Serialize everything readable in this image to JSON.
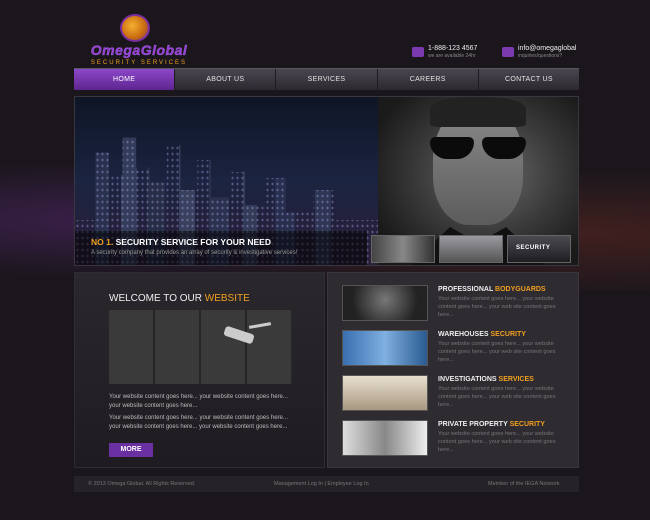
{
  "brand": {
    "name": "OmegaGlobal",
    "tagline": "SECURITY SERVICES"
  },
  "contact": {
    "phone": "1-888-123 4567",
    "phone_sub": "we are available 24hr",
    "email": "info@omegaglobal",
    "email_sub": "inquiries/questions?"
  },
  "nav": {
    "items": [
      {
        "label": "HOME"
      },
      {
        "label": "ABOUT US"
      },
      {
        "label": "SERVICES"
      },
      {
        "label": "CAREERS"
      },
      {
        "label": "CONTACT US"
      }
    ]
  },
  "hero": {
    "title_hl": "NO 1.",
    "title_rest": " SECURITY SERVICE FOR YOUR NEED",
    "desc": "A security company that provides an array of security & investigative services!",
    "thumbs": [
      {
        "label": ""
      },
      {
        "label": ""
      },
      {
        "label": "SECURITY"
      }
    ]
  },
  "welcome": {
    "title_plain": "WELCOME TO OUR ",
    "title_hl": "WEBSITE",
    "para1": "Your website content goes here... your website content goes here... your website content goes here...",
    "para2": "Your website content goes here... your website content goes here... your website content goes here... your website content goes here...",
    "more_label": "MORE"
  },
  "services": [
    {
      "title_plain": "PROFESSIONAL ",
      "title_hl": "BODYGUARDS",
      "text": "Your website content goes here... your website content goes here... your web site content goes here..."
    },
    {
      "title_plain": "WAREHOUSES ",
      "title_hl": "SECURITY",
      "text": "Your website content goes here... your website content goes here... your web site content goes here..."
    },
    {
      "title_plain": "INVESTIGATIONS ",
      "title_hl": "SERVICES",
      "text": "Your website content goes here... your website content goes here... your web site content goes here..."
    },
    {
      "title_plain": "PRIVATE PROPERTY ",
      "title_hl": "SECURITY",
      "text": "Your website content goes here... your website content goes here... your web site content goes here..."
    }
  ],
  "footer": {
    "copyright": "© 2013 Omega Global. All Rights Reserved.",
    "login_links": "Management Log In   |   Employee Log In",
    "member": "Member of the IEGA Network"
  },
  "colors": {
    "accent": "#f0a020",
    "brand_purple": "#6a2fa0",
    "background": "#1a161c"
  }
}
